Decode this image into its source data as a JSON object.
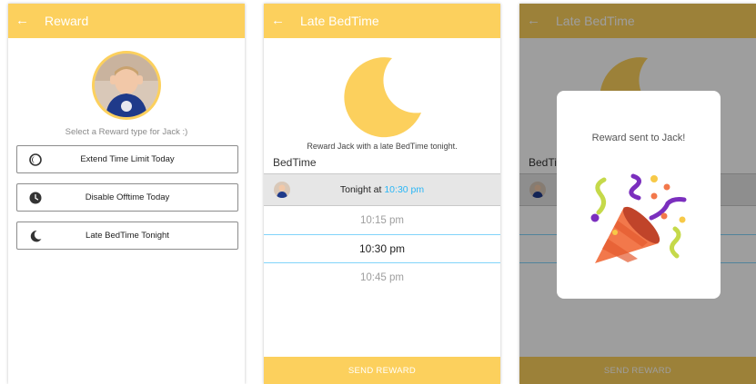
{
  "screen1": {
    "title": "Reward",
    "select_label": "Select a Reward type for Jack :)",
    "options": [
      {
        "label": "Extend Time Limit Today",
        "icon": "half-moon-circle-icon"
      },
      {
        "label": "Disable Offtime Today",
        "icon": "clock-icon"
      },
      {
        "label": "Late BedTime Tonight",
        "icon": "crescent-moon-icon"
      }
    ]
  },
  "screen2": {
    "title": "Late BedTime",
    "reward_text": "Reward Jack with a late BedTime tonight.",
    "bedtime_label": "BedTime",
    "tonight_prefix": "Tonight at",
    "tonight_time": "10:30 pm",
    "picker": [
      "10:15 pm",
      "10:30 pm",
      "10:45 pm"
    ],
    "selected_index": 1,
    "send_label": "SEND REWARD"
  },
  "screen3": {
    "title": "Late BedTime",
    "bedtime_label": "BedTi",
    "dialog_message": "Reward sent to Jack!",
    "send_label": "SEND REWARD"
  },
  "colors": {
    "accent": "#FCD05D",
    "time_highlight": "#29B6F6",
    "picker_line": "#81D4FA"
  }
}
